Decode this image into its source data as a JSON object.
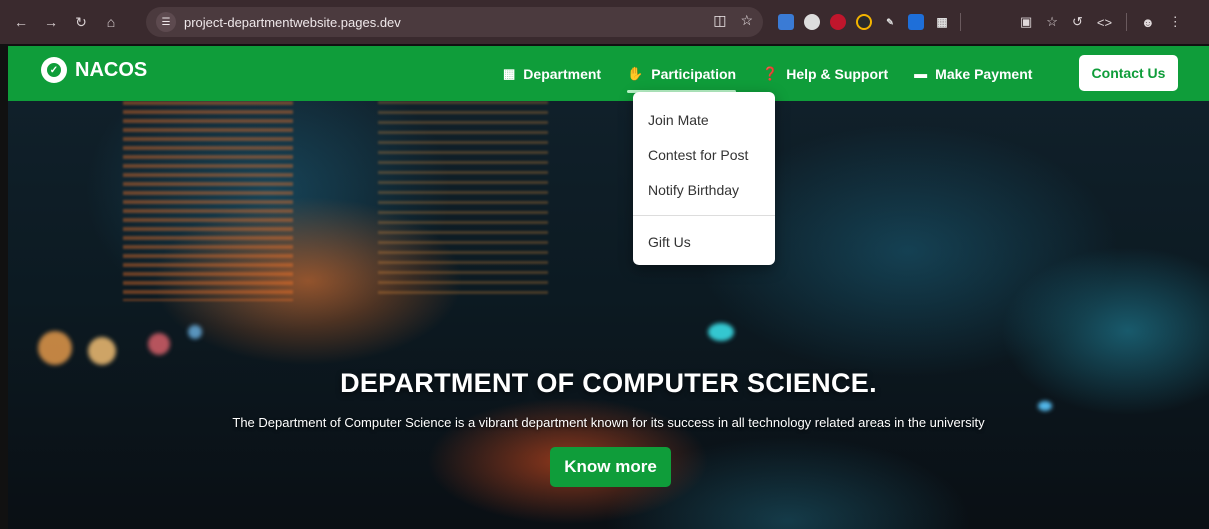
{
  "browser": {
    "url": "project-departmentwebsite.pages.dev"
  },
  "site": {
    "brand": "NACOS",
    "nav": [
      {
        "label": "Department",
        "icon": "building-icon"
      },
      {
        "label": "Participation",
        "icon": "handshake-icon"
      },
      {
        "label": "Help & Support",
        "icon": "question-circle-icon"
      },
      {
        "label": "Make Payment",
        "icon": "wallet-icon"
      }
    ],
    "contact_label": "Contact Us",
    "dropdown": {
      "items": [
        "Join Mate",
        "Contest for Post",
        "Notify Birthday"
      ],
      "extra": "Gift Us"
    }
  },
  "hero": {
    "title": "DEPARTMENT OF COMPUTER SCIENCE.",
    "subtitle": "The Department of Computer Science is a vibrant department known for its success in all technology related areas in the university",
    "button": "Know more"
  },
  "colors": {
    "brand_green": "#0f9d3a",
    "chrome_bg": "#3a2a2e"
  }
}
